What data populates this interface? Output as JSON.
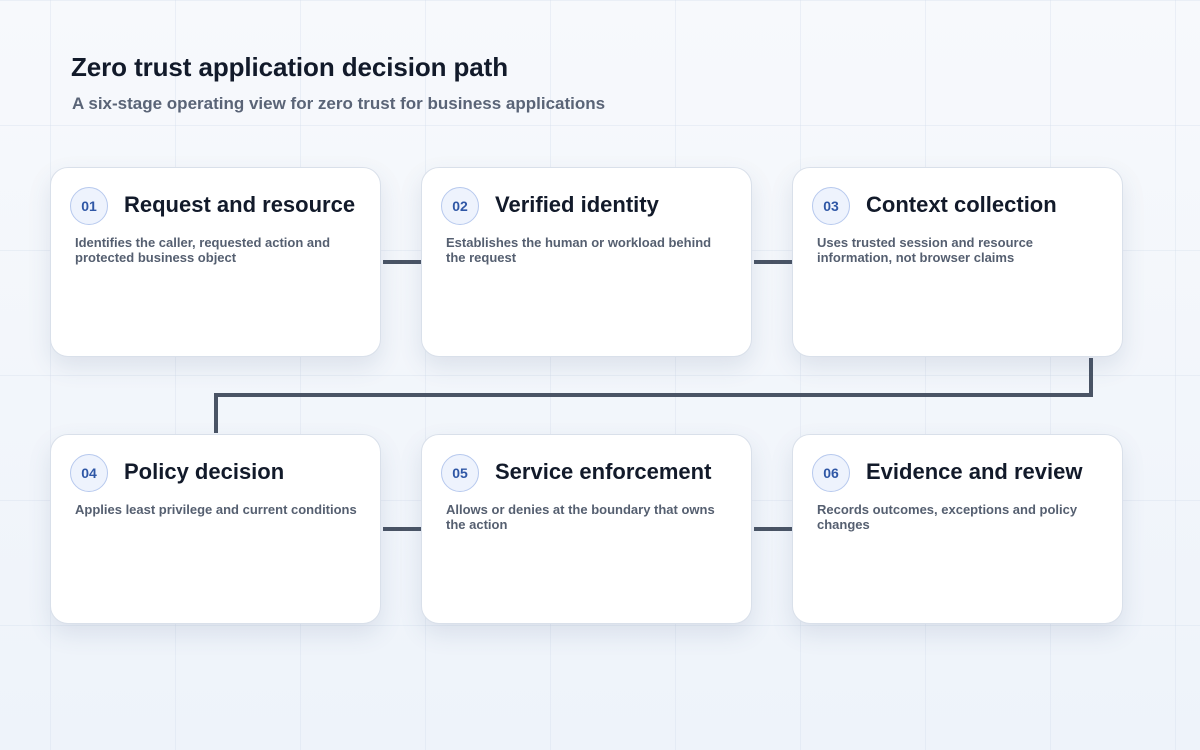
{
  "header": {
    "title": "Zero trust application decision path",
    "subtitle": "A six-stage operating view for zero trust for business applications"
  },
  "colors": {
    "connector": "#4a5465",
    "badge_text": "#2f57a6",
    "badge_fill": "#eef3fd",
    "badge_border": "#b7c9ee",
    "card_background": "#ffffff",
    "title_text": "#121a2a",
    "body_text": "#555f70"
  },
  "stages": [
    {
      "number": "01",
      "title": "Request and resource",
      "description": "Identifies the caller, requested action and protected business object"
    },
    {
      "number": "02",
      "title": "Verified identity",
      "description": "Establishes the human or workload behind the request"
    },
    {
      "number": "03",
      "title": "Context collection",
      "description": "Uses trusted session and resource information, not browser claims"
    },
    {
      "number": "04",
      "title": "Policy decision",
      "description": "Applies least privilege and current conditions"
    },
    {
      "number": "05",
      "title": "Service enforcement",
      "description": "Allows or denies at the boundary that owns the action"
    },
    {
      "number": "06",
      "title": "Evidence and review",
      "description": "Records outcomes, exceptions and policy changes"
    }
  ]
}
